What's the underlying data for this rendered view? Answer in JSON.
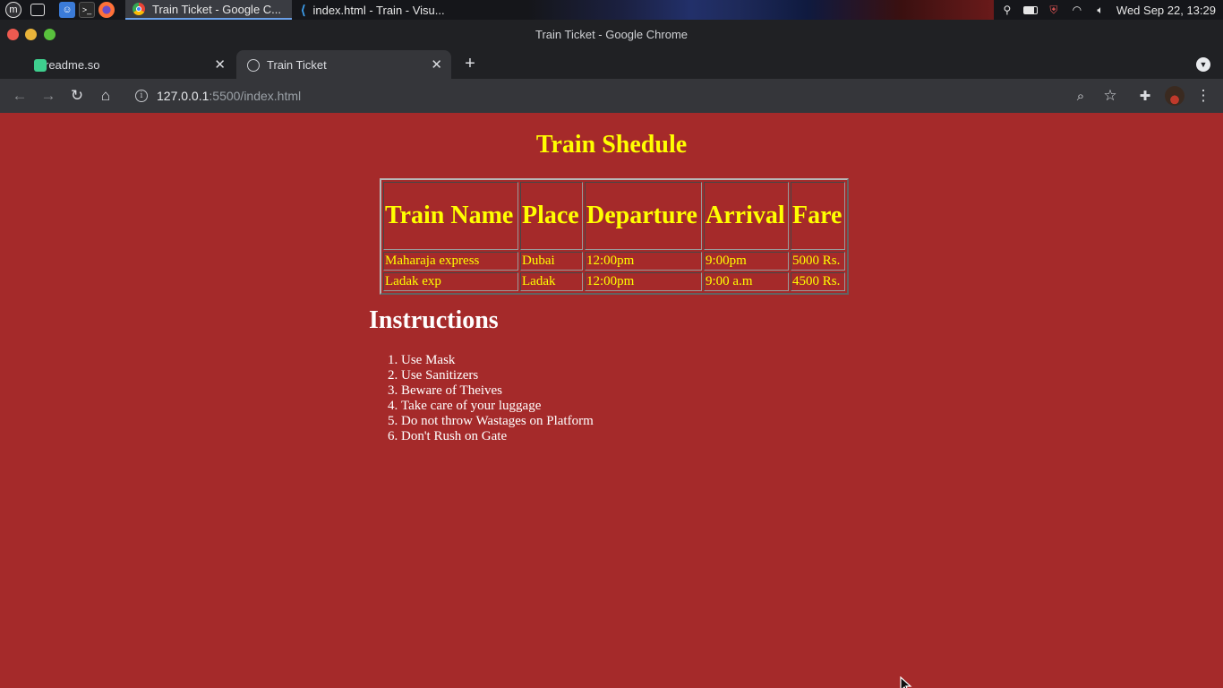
{
  "taskbar": {
    "tasks": [
      {
        "label": "Train Ticket - Google C..."
      },
      {
        "label": "index.html - Train - Visu..."
      }
    ],
    "clock": "Wed Sep 22, 13:29"
  },
  "window": {
    "title": "Train Ticket - Google Chrome"
  },
  "tabs": [
    {
      "label": "readme.so"
    },
    {
      "label": "Train Ticket"
    }
  ],
  "address_bar": {
    "host": "127.0.0.1",
    "rest": ":5500/index.html"
  },
  "page": {
    "title": "Train Shedule",
    "table": {
      "headers": [
        "Train Name",
        "Place",
        "Departure",
        "Arrival",
        "Fare"
      ],
      "rows": [
        [
          "Maharaja express",
          "Dubai",
          "12:00pm",
          "9:00pm",
          "5000 Rs."
        ],
        [
          "Ladak exp",
          "Ladak",
          "12:00pm",
          "9:00 a.m",
          "4500 Rs."
        ]
      ]
    },
    "instructions_heading": "Instructions",
    "instructions": [
      "Use Mask",
      "Use Sanitizers",
      "Beware of Theives",
      "Take care of your luggage",
      "Do not throw Wastages on Platform",
      "Don't Rush on Gate"
    ]
  },
  "colors": {
    "page_background": "#a52a2a",
    "heading_yellow": "#ffff00",
    "text_white": "#ffffff",
    "chrome_dark": "#202124"
  },
  "icons": [
    "mint-menu-icon",
    "files-icon",
    "finder-icon",
    "terminal-icon",
    "firefox-icon",
    "chrome-icon",
    "vscode-icon",
    "location-icon",
    "battery-icon",
    "shield-icon",
    "wifi-icon",
    "volume-icon",
    "info-icon",
    "zoom-icon",
    "star-icon",
    "extensions-icon",
    "menu-icon"
  ]
}
